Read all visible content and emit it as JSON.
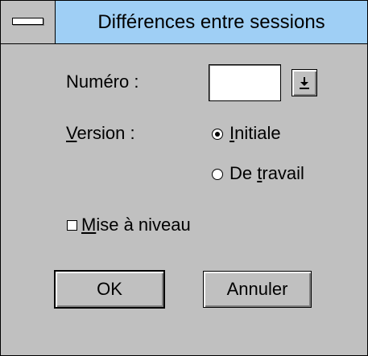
{
  "window": {
    "title": "Différences entre sessions",
    "system_menu_icon": "system-menu-icon"
  },
  "fields": {
    "numero_label": "Numéro :",
    "numero_value": "",
    "version_label_mnemonic": "V",
    "version_label_rest": "ersion :",
    "dropdown_icon": "arrow-down-icon"
  },
  "version_options": [
    {
      "mnemonic": "I",
      "rest": "nitiale",
      "prefix": "",
      "selected": true
    },
    {
      "prefix": "De ",
      "mnemonic": "t",
      "rest": "ravail",
      "selected": false
    }
  ],
  "checkbox": {
    "mnemonic": "M",
    "rest": "ise à niveau",
    "checked": false
  },
  "buttons": {
    "ok": "OK",
    "cancel": "Annuler"
  },
  "colors": {
    "titlebar": "#9fcff5",
    "face": "#c0c0c0"
  }
}
